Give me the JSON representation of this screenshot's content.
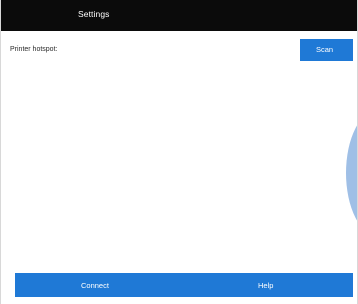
{
  "header": {
    "title": "Settings"
  },
  "printer": {
    "hotspot_label": "Printer hotspot:",
    "scan_label": "Scan"
  },
  "footer": {
    "connect_label": "Connect",
    "help_label": "Help"
  },
  "colors": {
    "titlebar": "#0b0b0b",
    "accent": "#1f79d6",
    "side_disc": "#9fbfe6"
  }
}
